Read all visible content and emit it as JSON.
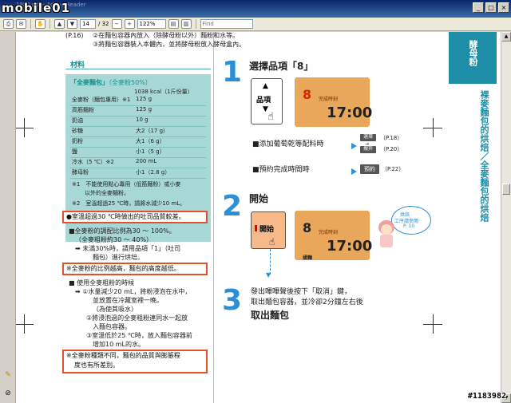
{
  "window": {
    "title": "1850.pdf - Adobe Reader",
    "watermark_logo": "mobile01"
  },
  "toolbar": {
    "page_current": "14",
    "page_total": "/ 32",
    "zoom": "122%",
    "find_placeholder": "Find"
  },
  "page_top": {
    "ref": "(P.16)",
    "line2": "②在麵包容器內放入（除酵母粉以外）麵粉和水等。",
    "line3": "③將麵包容器裝入本體內，並將酵母粉放入酵母盒內。"
  },
  "materials": {
    "title": "材料",
    "recipe_title": "「全麥麵包」",
    "recipe_sub": "（全麥粉50%）",
    "kcal": "1038 kcal（1斤份量）",
    "rows": [
      {
        "name": "全麥粉（麵包專用）※1",
        "value": "125 g"
      },
      {
        "name": "高筋麵粉",
        "value": "125 g"
      },
      {
        "name": "奶油",
        "value": "10 g"
      },
      {
        "name": "砂糖",
        "value": "大2（17 g）"
      },
      {
        "name": "奶粉",
        "value": "大1（6 g）"
      },
      {
        "name": "鹽",
        "value": "小1（5 g）"
      },
      {
        "name": "冷水（5 ℃）※2",
        "value": "200 mL"
      },
      {
        "name": "酵母粉",
        "value": "小1（2.8 g）"
      }
    ],
    "note1a": "※1　不能使用點心專用（低筋麵粉）或小麥",
    "note1b": "以外的全麥麵粉。",
    "note2": "※2　室溫超過25 ℃時，請將水減少10 mL。"
  },
  "tips": {
    "box1": "●室溫超過30 ℃時做出的吐司品質較差。",
    "b2_head": "■全麥粉的調配比例為30 〜 100%。",
    "b2_l1": "（全麥粗粉約30 〜 40%）",
    "b2_l2": "➡ 未滿30%時，請用品項「1」（吐司",
    "b2_l3": "麵包）進行烘培。",
    "box2": "※全麥粉的比例越高，麵包的高度越低。",
    "b3_head": "■ 使用全麥粗粉的時候",
    "b3_l1": "➡ ①水量減少20 mL，將粉浸泡在水中，",
    "b3_l2": "並放置在冷藏室裡一晚。",
    "b3_l3": "（為使其吸水）",
    "b3_l4": "②將浸泡過的全麥粗粉連同水一起放",
    "b3_l5": "入麵包容器。",
    "b3_l6": "③室溫低於25 ℃時，放入麵包容器前",
    "b3_l7": "增加10 mL的水。",
    "box3a": "※全麥粉種類不同，麵包的品質與膨脹程",
    "box3b": "度也有所差別。"
  },
  "steps": {
    "s1_no": "1",
    "s1_head": "選擇品項「8」",
    "s1_btn": "品項",
    "lcd_menu": "8",
    "lcd_label": "完成時刻",
    "lcd_time": "17:00",
    "s1_opt1": "■添加葡萄乾等配料時",
    "s1_opt1_btn1": "選擇",
    "s1_opt1_btn2": "攪拌",
    "s1_opt1_ref1": "（P.18）",
    "s1_opt1_ref2": "（P.20）",
    "s1_opt2": "■預約完成時間時",
    "s1_opt2_btn": "預約",
    "s1_opt2_ref": "（P.22）",
    "s2_no": "2",
    "s2_head": "開始",
    "s2_btn": "開始",
    "lcd2_time": "17:00",
    "lcd2_sub": "揉麵",
    "bubble_l1": "烘焙",
    "bubble_l2": "工序請參閱",
    "bubble_l3": "P. 10",
    "s3_no": "3",
    "s3_l1": "發出嗶嗶聲後按下「取消」鍵，",
    "s3_l2": "取出麵包容器，並冷卻2分鐘左右後",
    "s3_l3": "取出麵包"
  },
  "sidebar": {
    "tab": "酵母粉",
    "vertical": "裸麥麵包的烘焙／全麥麵包的烘焙"
  },
  "footer": {
    "watermark_id": "#1183982"
  }
}
